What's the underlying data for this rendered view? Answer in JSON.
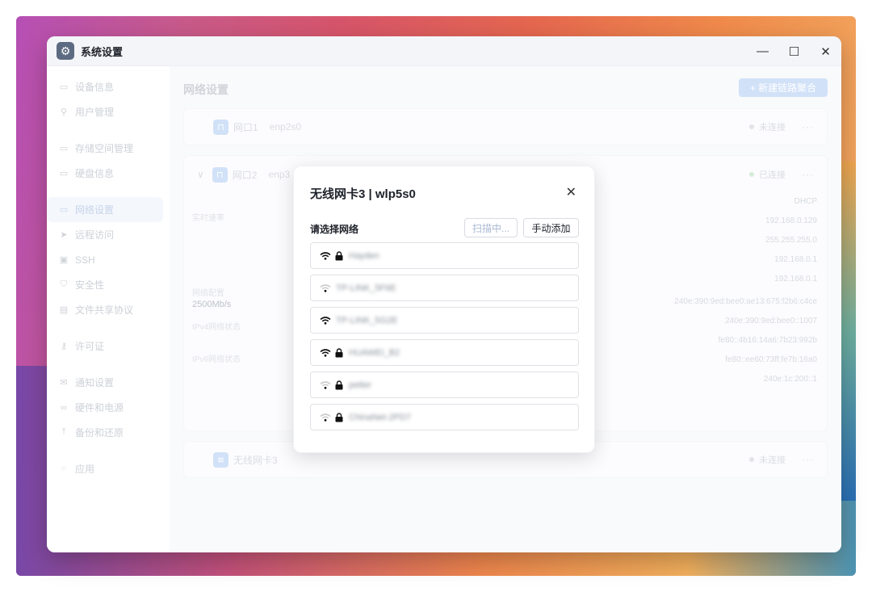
{
  "window": {
    "title": "系统设置",
    "controls": {
      "minimize": "—",
      "maximize": "☐",
      "close": "✕"
    }
  },
  "sidebar": {
    "items": [
      {
        "label": "设备信息",
        "icon": "device-icon"
      },
      {
        "label": "用户管理",
        "icon": "users-icon"
      },
      {
        "label": "存储空间管理",
        "icon": "storage-icon"
      },
      {
        "label": "硬盘信息",
        "icon": "disk-icon"
      },
      {
        "label": "网络设置",
        "icon": "network-icon"
      },
      {
        "label": "远程访问",
        "icon": "send-icon"
      },
      {
        "label": "SSH",
        "icon": "terminal-icon"
      },
      {
        "label": "安全性",
        "icon": "shield-icon"
      },
      {
        "label": "文件共享协议",
        "icon": "file-icon"
      },
      {
        "label": "许可证",
        "icon": "key-icon"
      },
      {
        "label": "通知设置",
        "icon": "mail-icon"
      },
      {
        "label": "硬件和电源",
        "icon": "hardware-icon"
      },
      {
        "label": "备份和还原",
        "icon": "backup-icon"
      },
      {
        "label": "应用",
        "icon": "apps-icon"
      }
    ]
  },
  "main": {
    "title": "网络设置",
    "new_button": "+ 新建链路聚合",
    "port1": {
      "name": "网口1",
      "iface": "enp2s0",
      "status": "未连接",
      "more": "···"
    },
    "port2": {
      "name": "网口2",
      "iface": "enp3",
      "status": "已连接",
      "more": "···",
      "chevron": "∨",
      "realtime_label": "实时速率",
      "config_label": "网络配置",
      "speed": "2500Mb/s",
      "ipv4_label": "IPv4网络状态",
      "ipv6_label": "IPv6网络状态",
      "values": [
        "DHCP",
        "192.168.0.129",
        "255.255.255.0",
        "192.168.0.1",
        "192.168.0.1",
        "240e:390:9ed:bee0:ae13:675:f2b6:c4ce",
        "240e:390:9ed:bee0::1007",
        "fe80::4b16:14a6:7b23:992b",
        "fe80::ee60:73ff:fe7b:16a0",
        "240e:1c:200::1"
      ]
    },
    "wifi": {
      "name": "无线网卡3",
      "status": "未连接",
      "more": "···"
    }
  },
  "dialog": {
    "title": "无线网卡3 | wlp5s0",
    "close": "✕",
    "subtitle": "请选择网络",
    "scan_button": "扫描中...",
    "manual_button": "手动添加",
    "networks": [
      {
        "ssid": "Hayden",
        "signal": "strong",
        "locked": true
      },
      {
        "ssid": "TP-LINK_5F6E",
        "signal": "weak",
        "locked": false
      },
      {
        "ssid": "TP-LINK_5G2E",
        "signal": "strong",
        "locked": false
      },
      {
        "ssid": "HUAWEI_B2",
        "signal": "strong",
        "locked": true
      },
      {
        "ssid": "petter",
        "signal": "weak",
        "locked": true
      },
      {
        "ssid": "ChinaNet-2PD7",
        "signal": "weak",
        "locked": true
      }
    ]
  }
}
